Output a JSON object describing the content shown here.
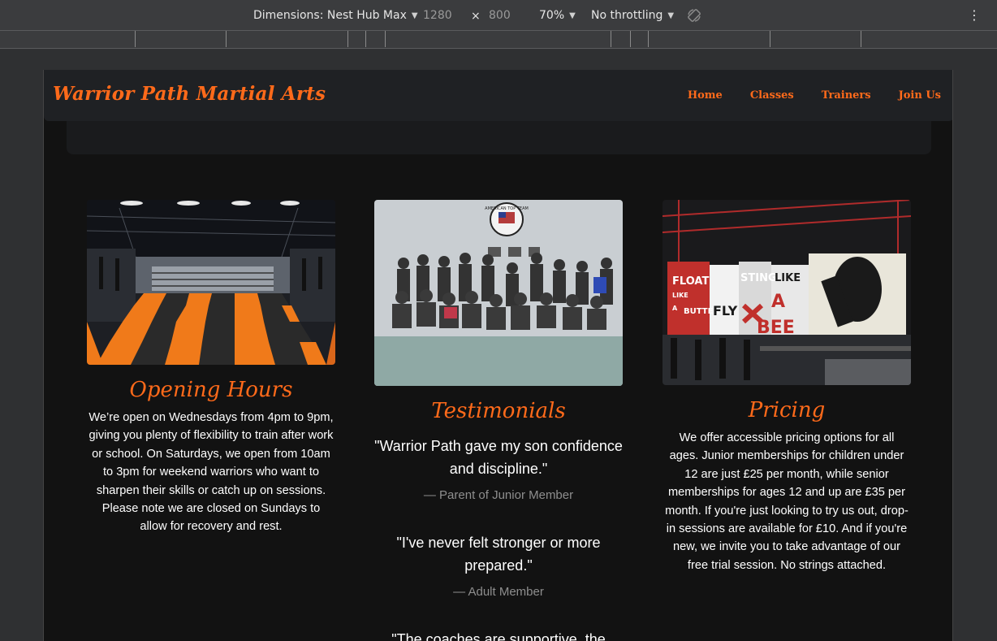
{
  "devtools": {
    "dimensions_label": "Dimensions: Nest Hub Max",
    "width": "1280",
    "times": "×",
    "height": "800",
    "zoom": "70%",
    "throttling": "No throttling",
    "more_icon": "⋮"
  },
  "site": {
    "brand": "Warrior Path Martial Arts",
    "nav": [
      "Home",
      "Classes",
      "Trainers",
      "Join Us"
    ],
    "accent": "#ff6a1a"
  },
  "cards": {
    "hours": {
      "title": "Opening Hours",
      "body": "We’re open on Wednesdays from 4pm to 9pm, giving you plenty of flexibility to train after work or school. On Saturdays, we open from 10am to 3pm for weekend warriors who want to sharpen their skills or catch up on sessions. Please note we are closed on Sundays to allow for recovery and rest."
    },
    "testimonials": {
      "title": "Testimonials",
      "items": [
        {
          "quote": "\"Warrior Path gave my son confidence and discipline.\"",
          "author": "— Parent of Junior Member"
        },
        {
          "quote": "\"I've never felt stronger or more prepared.\"",
          "author": "— Adult Member"
        },
        {
          "quote": "\"The coaches are supportive, the"
        }
      ]
    },
    "pricing": {
      "title": "Pricing",
      "body": "We offer accessible pricing options for all ages. Junior memberships for children under 12 are just £25 per month, while senior memberships for ages 12 and up are £35 per month. If you're just looking to try us out, drop-in sessions are available for £10. And if you're new, we invite you to take advantage of our free trial session. No strings attached."
    }
  },
  "mural_text": {
    "left": [
      "FLOAT",
      "LIKE",
      "A",
      "BUTTER",
      "FLY"
    ],
    "right": [
      "STING",
      "LIKE",
      "A",
      "BEE"
    ]
  },
  "logo_text": "AMERICAN TOP TEAM"
}
